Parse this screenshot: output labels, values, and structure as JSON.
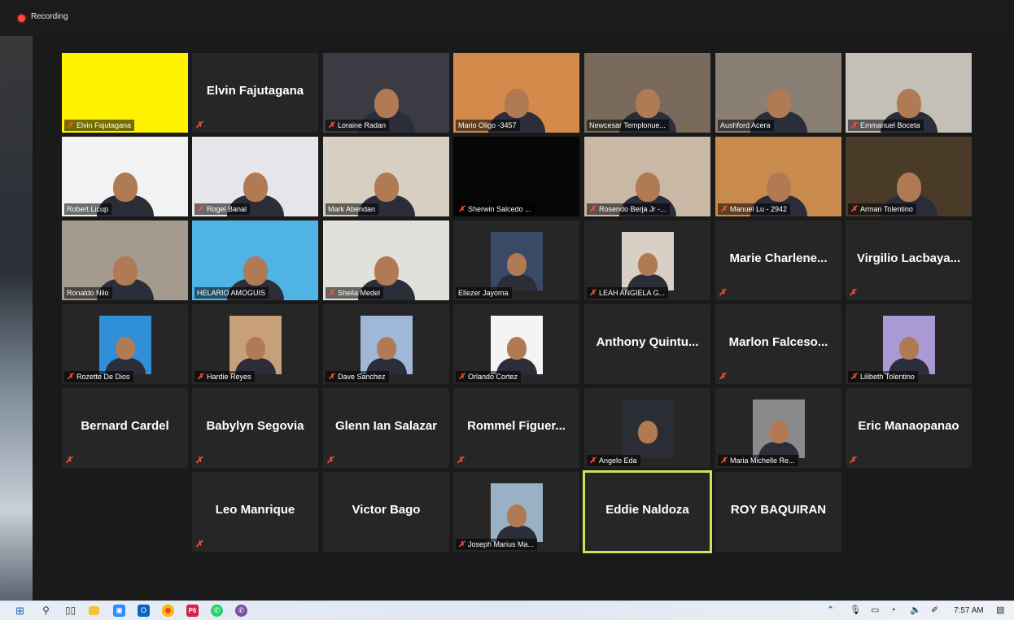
{
  "recording": {
    "label": "Recording"
  },
  "taskbar": {
    "time": "7:57 AM",
    "apps": [
      "start",
      "search",
      "task-view",
      "file-explorer",
      "zoom",
      "outlook",
      "chrome",
      "primavera",
      "whatsapp",
      "viber"
    ]
  },
  "participants": [
    {
      "name": "Elvin Fajutagana",
      "label": "Elvin Fajutagana",
      "type": "video",
      "bg": "#fff200",
      "muted": true
    },
    {
      "name": "Elvin Fajutagana",
      "label": "",
      "type": "name",
      "muted": true
    },
    {
      "name": "Loraine Radan",
      "label": "Loraine Radan",
      "type": "video",
      "bg": "#3b3b44",
      "muted": true
    },
    {
      "name": "Mario Oligo -3457",
      "label": "Mario Oligo -3457",
      "type": "video",
      "bg": "#d48a4a",
      "muted": false
    },
    {
      "name": "Newcesar Templonue...",
      "label": "Newcesar Templonue...",
      "type": "video",
      "bg": "#7a6a5c",
      "muted": false
    },
    {
      "name": "Aushford Acera",
      "label": "Aushford Acera",
      "type": "video",
      "bg": "#8a7f74",
      "muted": false
    },
    {
      "name": "Emmanuel Boceta",
      "label": "Emmanuel Boceta",
      "type": "video",
      "bg": "#c4c0b8",
      "muted": true
    },
    {
      "name": "Robert Licup",
      "label": "Robert Licup",
      "type": "video",
      "bg": "#f2f2f2",
      "muted": false
    },
    {
      "name": "Rogel Banal",
      "label": "Rogel Banal",
      "type": "video",
      "bg": "#e6e6ea",
      "muted": true
    },
    {
      "name": "Mark Abendan",
      "label": "Mark Abendan",
      "type": "video",
      "bg": "#d6cfc2",
      "muted": false
    },
    {
      "name": "Sherwin Salcedo ...",
      "label": "Sherwin Salcedo ...",
      "type": "black",
      "muted": true
    },
    {
      "name": "Rosendo Berja Jr -...",
      "label": "Rosendo Berja Jr -...",
      "type": "video",
      "bg": "#c9b8a6",
      "muted": true
    },
    {
      "name": "Manuel Lu - 2942",
      "label": "Manuel Lu - 2942",
      "type": "video",
      "bg": "#c98a4e",
      "muted": true
    },
    {
      "name": "Arman Tolentino",
      "label": "Arman Tolentino",
      "type": "video",
      "bg": "#4a3a28",
      "muted": true
    },
    {
      "name": "Ronaldo Nilo",
      "label": "Ronaldo Nilo",
      "type": "video",
      "bg": "#a49a8e",
      "muted": false
    },
    {
      "name": "HELARIO AMOGUIS",
      "label": "HELARIO AMOGUIS",
      "type": "video",
      "bg": "#4fb3e6",
      "muted": false
    },
    {
      "name": "Sheila Medel",
      "label": "Sheila Medel",
      "type": "video",
      "bg": "#e2e0da",
      "muted": true
    },
    {
      "name": "Ellezer Jayoma",
      "label": "Ellezer Jayoma",
      "type": "photo",
      "bg": "#3a4a66",
      "muted": false
    },
    {
      "name": "LEAH ANGIELA G...",
      "label": "LEAH ANGIELA G...",
      "type": "photo",
      "bg": "#d8d0c4",
      "muted": true
    },
    {
      "name": "Marie  Charlene...",
      "label": "",
      "type": "name",
      "muted": true
    },
    {
      "name": "Virgilio  Lacbaya...",
      "label": "",
      "type": "name",
      "muted": true
    },
    {
      "name": "Rozette De Dios",
      "label": "Rozette De Dios",
      "type": "photo",
      "bg": "#2f8fd8",
      "muted": true
    },
    {
      "name": "Hardie Reyes",
      "label": "Hardie Reyes",
      "type": "photo",
      "bg": "#c7a07a",
      "muted": true
    },
    {
      "name": "Dave Sanchez",
      "label": "Dave Sanchez",
      "type": "photo",
      "bg": "#9fb8d8",
      "muted": true
    },
    {
      "name": "Orlando Cortez",
      "label": "Orlando Cortez",
      "type": "photo",
      "bg": "#f4f4f4",
      "muted": true
    },
    {
      "name": "Anthony  Quintu...",
      "label": "",
      "type": "name",
      "muted": false
    },
    {
      "name": "Marlon  Falceso...",
      "label": "",
      "type": "name",
      "muted": true
    },
    {
      "name": "Lilibeth Tolentino",
      "label": "Lilibeth Tolentino",
      "type": "photo",
      "bg": "#a99ad6",
      "muted": true
    },
    {
      "name": "Bernard Cardel",
      "label": "",
      "type": "name",
      "muted": true
    },
    {
      "name": "Babylyn Segovia",
      "label": "",
      "type": "name",
      "muted": true
    },
    {
      "name": "Glenn Ian Salazar",
      "label": "",
      "type": "name",
      "muted": true
    },
    {
      "name": "Rommel  Figuer...",
      "label": "",
      "type": "name",
      "muted": true
    },
    {
      "name": "Angelo Eda",
      "label": "Angelo Eda",
      "type": "photo",
      "bg": "#2a2d33",
      "muted": true
    },
    {
      "name": "Maria Michelle Re...",
      "label": "Maria Michelle Re...",
      "type": "photo",
      "bg": "#8a8a8a",
      "muted": true
    },
    {
      "name": "Eric Manaopanao",
      "label": "",
      "type": "name",
      "muted": true
    },
    {
      "name": "Leo Manrique",
      "label": "",
      "type": "name",
      "muted": true
    },
    {
      "name": "Victor Bago",
      "label": "",
      "type": "name",
      "muted": false
    },
    {
      "name": "Joseph Marius Ma...",
      "label": "Joseph Marius Ma...",
      "type": "photo",
      "bg": "#9ab0c4",
      "muted": true
    },
    {
      "name": "Eddie Naldoza",
      "label": "",
      "type": "name",
      "muted": false,
      "active": true
    },
    {
      "name": "ROY BAQUIRAN",
      "label": "",
      "type": "name",
      "muted": false
    }
  ]
}
